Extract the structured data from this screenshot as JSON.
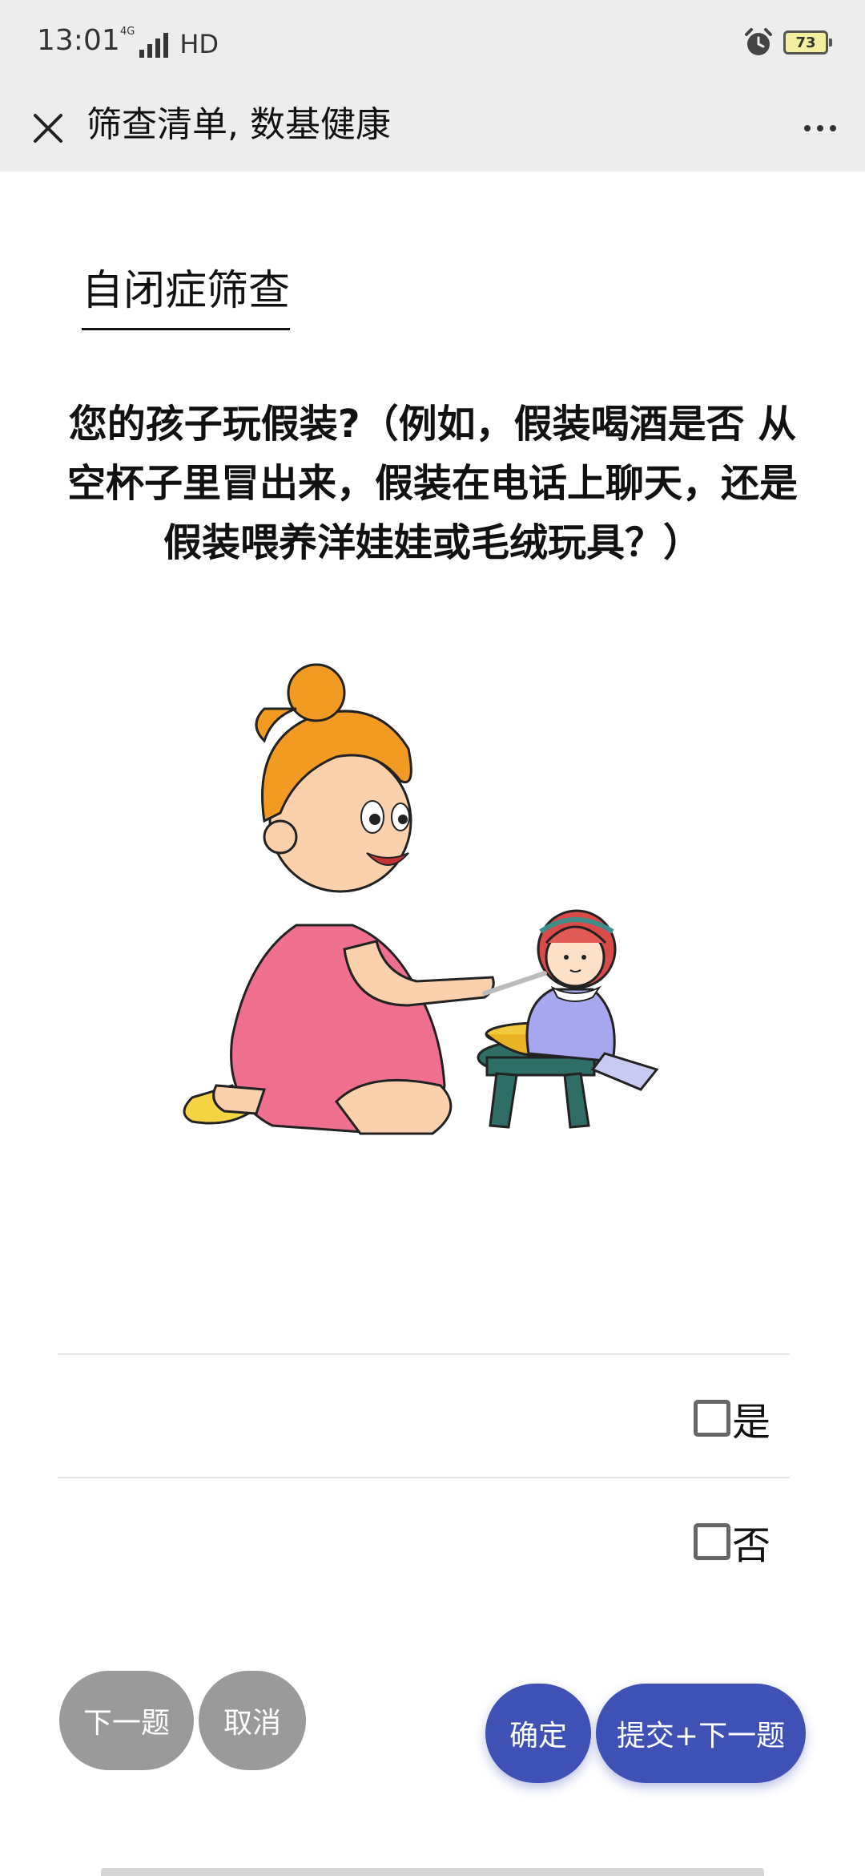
{
  "status_bar": {
    "time": "13:01",
    "network": "4G",
    "hd": "HD",
    "battery": "73"
  },
  "app_bar": {
    "title": "筛查清单, 数基健康"
  },
  "page": {
    "section_title": "自闭症筛查",
    "question": "您的孩子玩假装?（例如，假装喝酒是否 从空杯子里冒出来，假装在电话上聊天，还是假装喂养洋娃娃或毛绒玩具？）"
  },
  "options": [
    {
      "label": "是",
      "checked": false
    },
    {
      "label": "否",
      "checked": false
    }
  ],
  "buttons": {
    "next": "下一题",
    "cancel": "取消",
    "confirm": "确定",
    "submit_next": "提交+下一题"
  },
  "colors": {
    "primary": "#3f51b5",
    "secondary": "#9a9a9a",
    "header_bg": "#ededed"
  }
}
